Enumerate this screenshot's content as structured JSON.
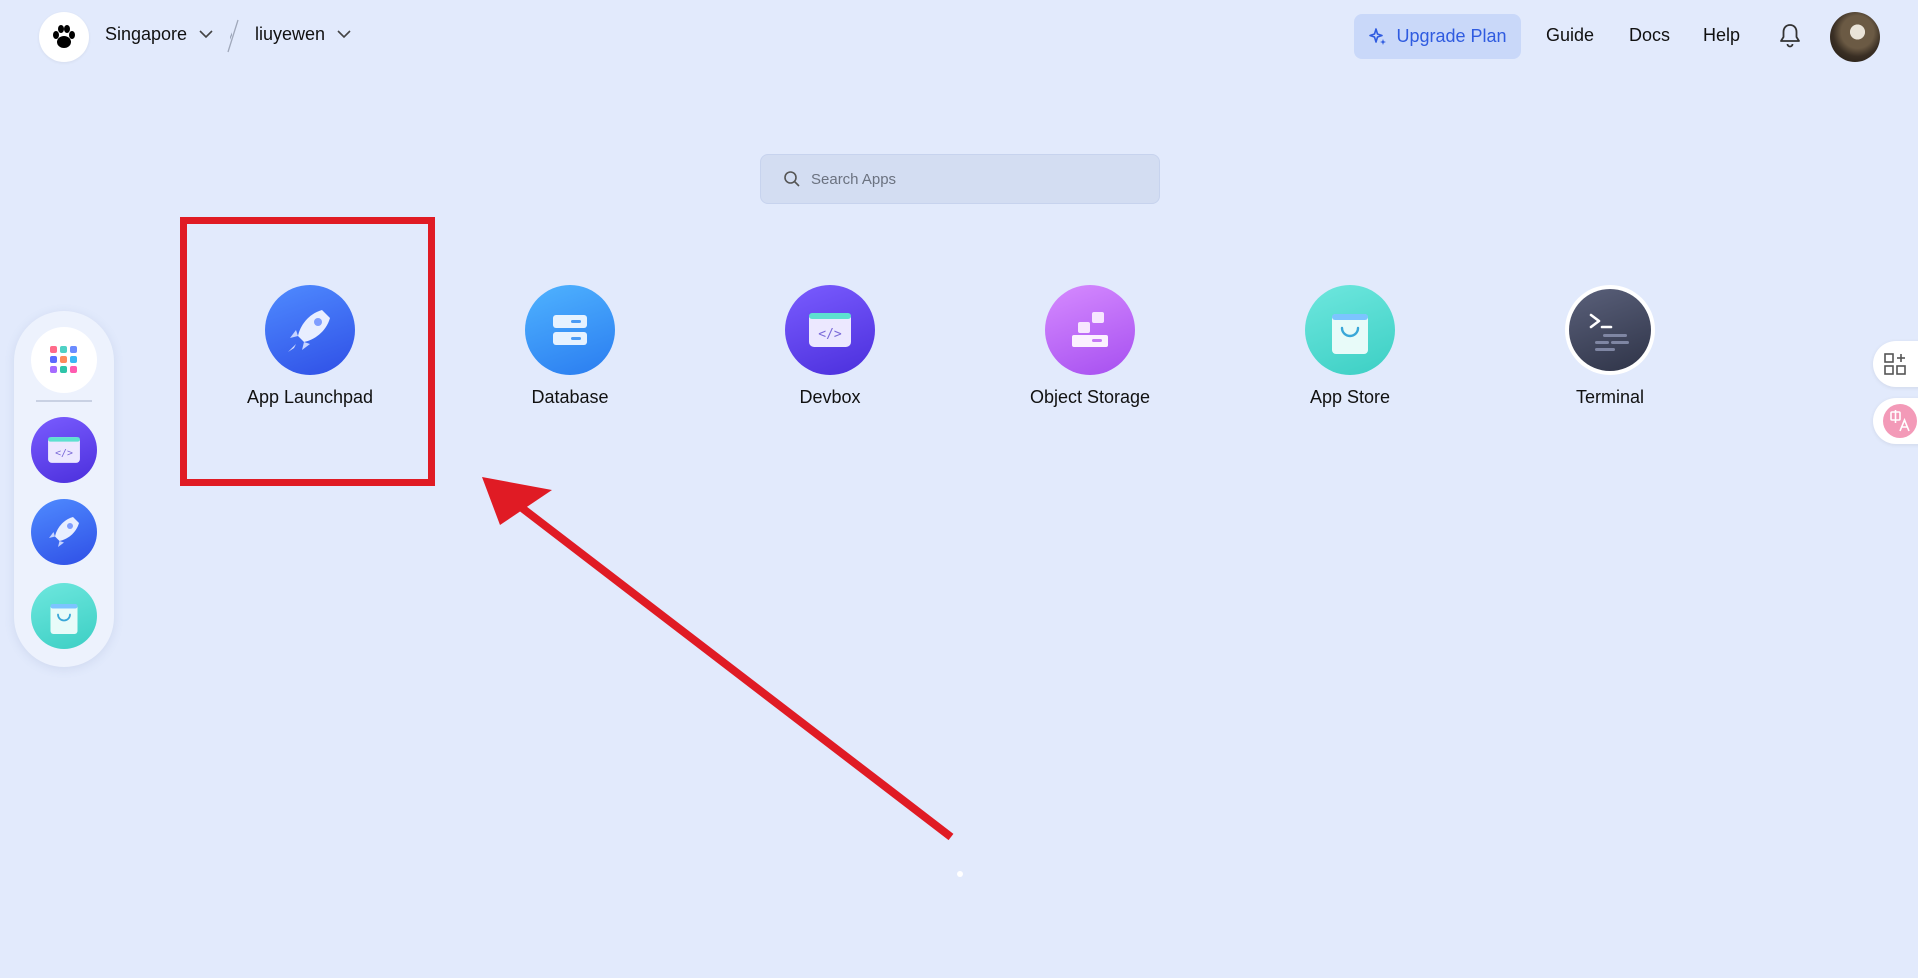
{
  "header": {
    "region": "Singapore",
    "workspace": "liuyewen",
    "upgrade_label": "Upgrade Plan",
    "nav": [
      "Guide",
      "Docs",
      "Help"
    ]
  },
  "search": {
    "placeholder": "Search Apps"
  },
  "apps": [
    {
      "label": "App Launchpad",
      "icon": "rocket-icon"
    },
    {
      "label": "Database",
      "icon": "database-icon"
    },
    {
      "label": "Devbox",
      "icon": "code-window-icon"
    },
    {
      "label": "Object Storage",
      "icon": "blocks-icon"
    },
    {
      "label": "App Store",
      "icon": "shopping-bag-icon"
    },
    {
      "label": "Terminal",
      "icon": "terminal-icon"
    }
  ],
  "dock": [
    "apps-grid-icon",
    "code-window-icon",
    "rocket-icon",
    "shopping-bag-icon"
  ],
  "colors": {
    "highlight": "#e01b24",
    "accent": "#2f5be0",
    "background": "#e2eafc"
  }
}
